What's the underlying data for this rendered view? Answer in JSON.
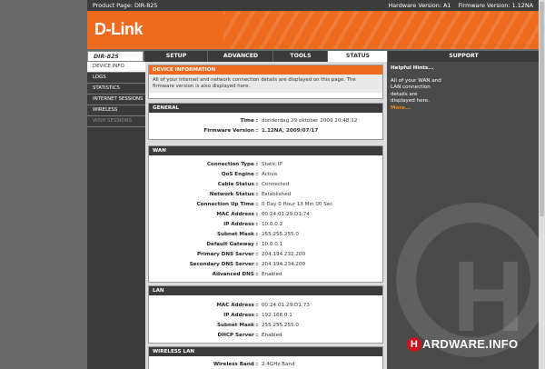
{
  "topbar": {
    "product": "Product Page: DIR-825",
    "hardware": "Hardware Version: A1",
    "firmware": "Firmware Version: 1.12NA"
  },
  "logo": "D-Link",
  "nav": {
    "model": "DIR-825",
    "tabs": [
      "SETUP",
      "ADVANCED",
      "TOOLS",
      "STATUS",
      "SUPPORT"
    ],
    "active": "STATUS"
  },
  "sidebar": {
    "items": [
      "DEVICE INFO",
      "LOGS",
      "STATISTICS",
      "INTERNET SESSIONS",
      "WIRELESS",
      "WISH SESSIONS"
    ]
  },
  "device_info": {
    "title": "DEVICE INFORMATION",
    "text": "All of your Internet and network connection details are displayed on this page. The firmware version is also displayed here."
  },
  "general": {
    "title": "GENERAL",
    "rows": [
      {
        "label": "Time :",
        "value": "donderdag 29 oktober 2009 20:48:12"
      },
      {
        "label": "Firmware Version :",
        "value": "1.12NA, 2009/07/17"
      }
    ]
  },
  "wan": {
    "title": "WAN",
    "rows": [
      {
        "label": "Connection Type :",
        "value": "Static IP"
      },
      {
        "label": "QoS Engine :",
        "value": "Active"
      },
      {
        "label": "Cable Status :",
        "value": "Connected"
      },
      {
        "label": "Network Status :",
        "value": "Established"
      },
      {
        "label": "Connection Up Time :",
        "value": "0 Day 0 Hour 13 Min 00 Sec"
      },
      {
        "label": "MAC Address :",
        "value": "00:24:01:29:D1:74"
      },
      {
        "label": "IP Address :",
        "value": "10.0.0.2"
      },
      {
        "label": "Subnet Mask :",
        "value": "255.255.255.0"
      },
      {
        "label": "Default Gateway :",
        "value": "10.0.0.1"
      },
      {
        "label": "Primary DNS Server :",
        "value": "204.194.232.200"
      },
      {
        "label": "Secondary DNS Server :",
        "value": "204.194.234.200"
      },
      {
        "label": "Advanced DNS :",
        "value": "Enabled"
      }
    ]
  },
  "lan": {
    "title": "LAN",
    "rows": [
      {
        "label": "MAC Address :",
        "value": "00:24:01:29:D1:73"
      },
      {
        "label": "IP Address :",
        "value": "192.168.0.1"
      },
      {
        "label": "Subnet Mask :",
        "value": "255.255.255.0"
      },
      {
        "label": "DHCP Server :",
        "value": "Enabled"
      }
    ]
  },
  "wireless": {
    "title": "WIRELESS LAN",
    "rows": [
      {
        "label": "Wireless Band :",
        "value": "2.4GHz Band"
      }
    ]
  },
  "hints": {
    "title": "Helpful Hints...",
    "text": "All of your WAN and LAN connection details are displayed here.",
    "more": "More..."
  },
  "watermark": {
    "letter": "H",
    "brand": "HARDWARE.INFO",
    "brand_circle": "H",
    "brand_rest": "ARDWARE.INFO"
  }
}
